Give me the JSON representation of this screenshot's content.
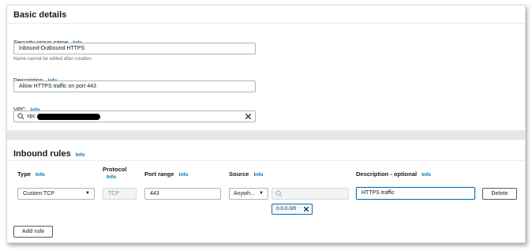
{
  "basic_details": {
    "title": "Basic details",
    "sg_name_label": "Security group name",
    "sg_name_info": "Info",
    "sg_name_value": "Inbound-Outbound HTTPS",
    "sg_name_hint": "Name cannot be edited after creation.",
    "description_label": "Description",
    "description_info": "Info",
    "description_value": "Allow HTTPS traffic on port 443",
    "vpc_label": "VPC",
    "vpc_info": "Info",
    "vpc_value": "vpc"
  },
  "inbound_rules": {
    "title": "Inbound rules",
    "title_info": "Info",
    "columns": {
      "type": "Type",
      "type_info": "Info",
      "protocol": "Protocol",
      "protocol_info": "Info",
      "port_range": "Port range",
      "port_range_info": "Info",
      "source": "Source",
      "source_info": "Info",
      "description": "Description - optional",
      "description_info": "Info"
    },
    "rows": [
      {
        "type": "Custom TCP",
        "protocol": "TCP",
        "port_range": "443",
        "source_type": "Anywh...",
        "source_search": "",
        "source_token": "0.0.0.0/0",
        "description": "HTTPS traffic",
        "delete_label": "Delete"
      }
    ],
    "add_rule_label": "Add rule"
  },
  "colors": {
    "accent": "#0073bb",
    "band": "#e4e7e8"
  }
}
